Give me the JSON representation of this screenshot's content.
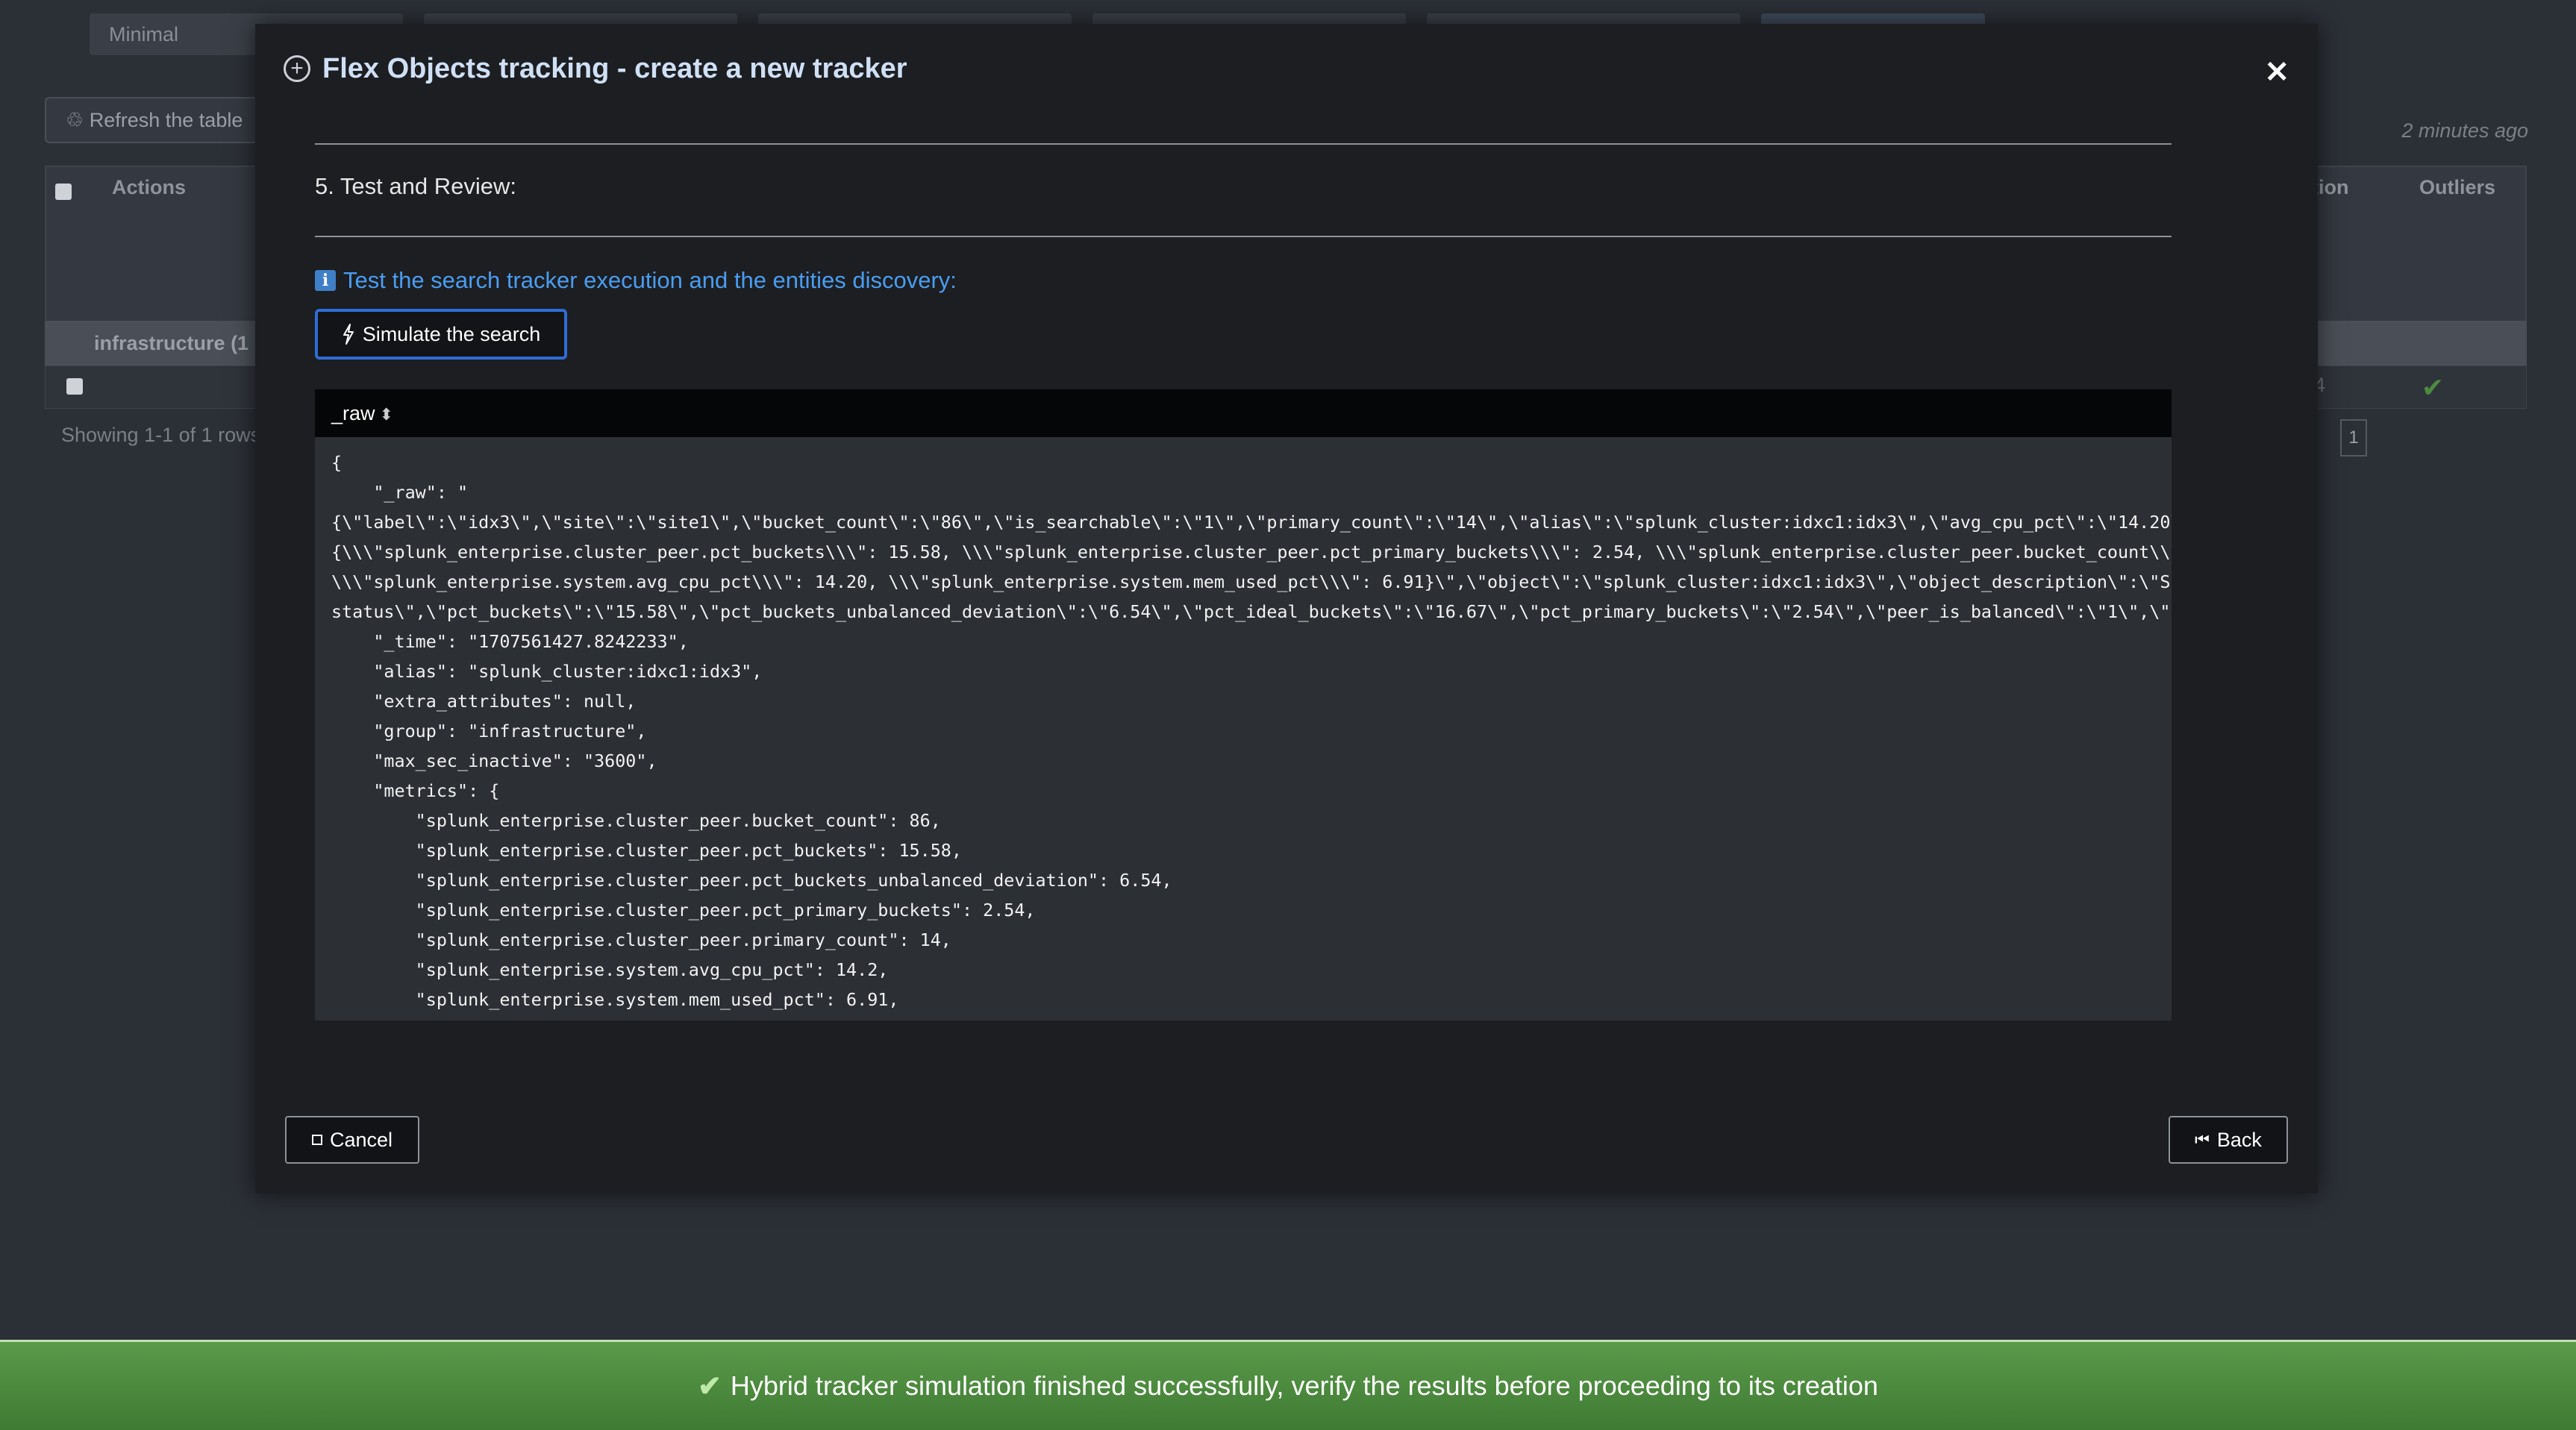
{
  "background": {
    "tab_label": "Minimal",
    "refresh_label": "Refresh the table",
    "last_updated": "2 minutes ago",
    "columns": {
      "actions": "Actions",
      "col_partial": "tion",
      "outliers": "Outliers"
    },
    "group_label": "infrastructure",
    "group_count_partial": "(1",
    "row_partial_value": "4",
    "showing": "Showing 1-1 of 1 rows",
    "page_number": "1"
  },
  "modal": {
    "title": "Flex Objects tracking - create a new tracker",
    "close_label": "✕",
    "section_title": "5. Test and Review:",
    "info_text": "Test the search tracker execution and the entities discovery:",
    "simulate_label": "Simulate the search",
    "results": {
      "column_header": "_raw",
      "raw_text": "{\n    \"_raw\": \"\n{\\\"label\\\":\\\"idx3\\\",\\\"site\\\":\\\"site1\\\",\\\"bucket_count\\\":\\\"86\\\",\\\"is_searchable\\\":\\\"1\\\",\\\"primary_count\\\":\\\"14\\\",\\\"alias\\\":\\\"splunk_cluster:idxc1:idx3\\\",\\\"avg_cpu_pct\\\":\\\"14.20\\\n{\\\\\\\"splunk_enterprise.cluster_peer.pct_buckets\\\\\\\": 15.58, \\\\\\\"splunk_enterprise.cluster_peer.pct_primary_buckets\\\\\\\": 2.54, \\\\\\\"splunk_enterprise.cluster_peer.bucket_count\\\\\\\n\\\\\\\"splunk_enterprise.system.avg_cpu_pct\\\\\\\": 14.20, \\\\\\\"splunk_enterprise.system.mem_used_pct\\\\\\\": 6.91}\\\",\\\"object\\\":\\\"splunk_cluster:idxc1:idx3\\\",\\\"object_description\\\":\\\"Sp\nstatus\\\",\\\"pct_buckets\\\":\\\"15.58\\\",\\\"pct_buckets_unbalanced_deviation\\\":\\\"6.54\\\",\\\"pct_ideal_buckets\\\":\\\"16.67\\\",\\\"pct_primary_buckets\\\":\\\"2.54\\\",\\\"peer_is_balanced\\\":\\\"1\\\",\\\"s\n    \"_time\": \"1707561427.8242233\",\n    \"alias\": \"splunk_cluster:idxc1:idx3\",\n    \"extra_attributes\": null,\n    \"group\": \"infrastructure\",\n    \"max_sec_inactive\": \"3600\",\n    \"metrics\": {\n        \"splunk_enterprise.cluster_peer.bucket_count\": 86,\n        \"splunk_enterprise.cluster_peer.pct_buckets\": 15.58,\n        \"splunk_enterprise.cluster_peer.pct_buckets_unbalanced_deviation\": 6.54,\n        \"splunk_enterprise.cluster_peer.pct_primary_buckets\": 2.54,\n        \"splunk_enterprise.cluster_peer.primary_count\": 14,\n        \"splunk_enterprise.system.avg_cpu_pct\": 14.2,\n        \"splunk_enterprise.system.mem_used_pct\": 6.91,"
    },
    "cancel_label": "Cancel",
    "back_label": "Back"
  },
  "toast": {
    "message": "Hybrid tracker simulation finished successfully, verify the results before proceeding to its creation",
    "color": "#4e8c3f"
  },
  "icons": {
    "title_icon": "plus-circle-icon",
    "info_icon": "info-icon",
    "simulate_icon": "lightning-icon",
    "cancel_icon": "square-icon",
    "back_icon": "rewind-icon",
    "toast_icon": "check-icon"
  }
}
